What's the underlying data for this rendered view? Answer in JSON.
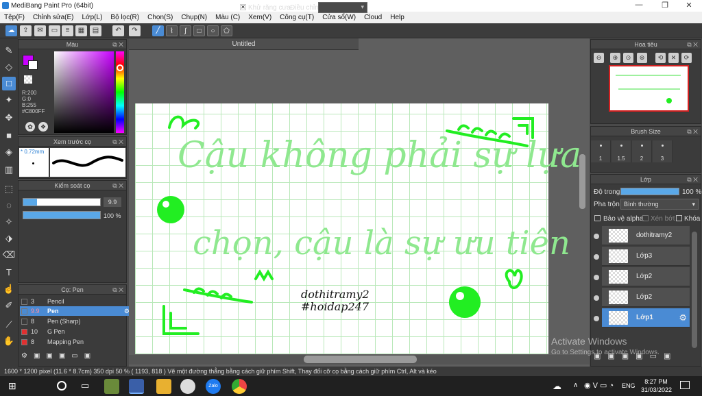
{
  "title": "MediBang Paint Pro (64bit)",
  "window_controls": {
    "min": "—",
    "max": "❐",
    "close": "✕"
  },
  "menu": [
    "Tệp(F)",
    "Chỉnh sửa(E)",
    "Lớp(L)",
    "Bộ lọc(R)",
    "Chọn(S)",
    "Chụp(N)",
    "Màu (C)",
    "Xem(V)",
    "Công cụ(T)",
    "Cửa sổ(W)",
    "Cloud",
    "Help"
  ],
  "toolbar": {
    "antialias_label": "Khử răng cưa",
    "antialias_checked": "✕",
    "fix_label": "Điều chỉnh"
  },
  "color_panel": {
    "title": "Màu",
    "r": "R:200",
    "g": "G:0",
    "b": "B:255",
    "hex": "#C800FF",
    "fg": "#c800ff"
  },
  "brush_preview": {
    "title": "Xem trước cọ",
    "size": "* 0.72mm"
  },
  "brush_control": {
    "title": "Kiểm soát cọ",
    "size_value": "9.9",
    "opacity_value": "100 %"
  },
  "brush_list": {
    "title": "Cọ: Pen",
    "items": [
      {
        "size": "3",
        "name": "Pencil",
        "color": "#333333"
      },
      {
        "size": "9.9",
        "name": "Pen",
        "color": "#333333"
      },
      {
        "size": "8",
        "name": "Pen (Sharp)",
        "color": "#333333"
      },
      {
        "size": "10",
        "name": "G Pen",
        "color": "#e03030"
      },
      {
        "size": "8",
        "name": "Mapping Pen",
        "color": "#e03030"
      }
    ]
  },
  "document": {
    "tab": "Untitled",
    "text_line1": "Cậu không phải sự lựa",
    "text_line2": "chọn, cậu là sự ưu tiên",
    "sig1": "dothitramy2",
    "sig2": "#hoidap247",
    "accent": "#22ee22"
  },
  "navigator": {
    "title": "Hoa tiêu"
  },
  "brush_size": {
    "title": "Brush Size",
    "sizes": [
      "1",
      "1.5",
      "2",
      "3"
    ]
  },
  "layers": {
    "title": "Lớp",
    "opacity_label": "Độ trong",
    "opacity_value": "100 %",
    "opacity_level": 100,
    "blend_label": "Pha trộn",
    "blend_value": "Bình thường",
    "protect_alpha": "Bảo vệ alpha",
    "clip": "Xén bớt",
    "lock": "Khóa",
    "items": [
      "dothitramy2",
      "Lớp3",
      "Lớp2",
      "Lớp2",
      "Lớp1"
    ]
  },
  "status_text": "1600 * 1200 pixel   (11.6 * 8.7cm)   350 dpi   50 %   ( 1193, 818 )   Vẽ một đường thẳng bằng cách giữ phím Shift, Thay đổi cỡ cọ bằng cách giữ phím Ctrl, Alt và kéo",
  "watermark": {
    "line1": "Activate Windows",
    "line2": "Go to Settings to activate Windows."
  },
  "taskbar": {
    "lang": "ENG",
    "time": "8:27 PM",
    "date": "31/03/2022"
  }
}
